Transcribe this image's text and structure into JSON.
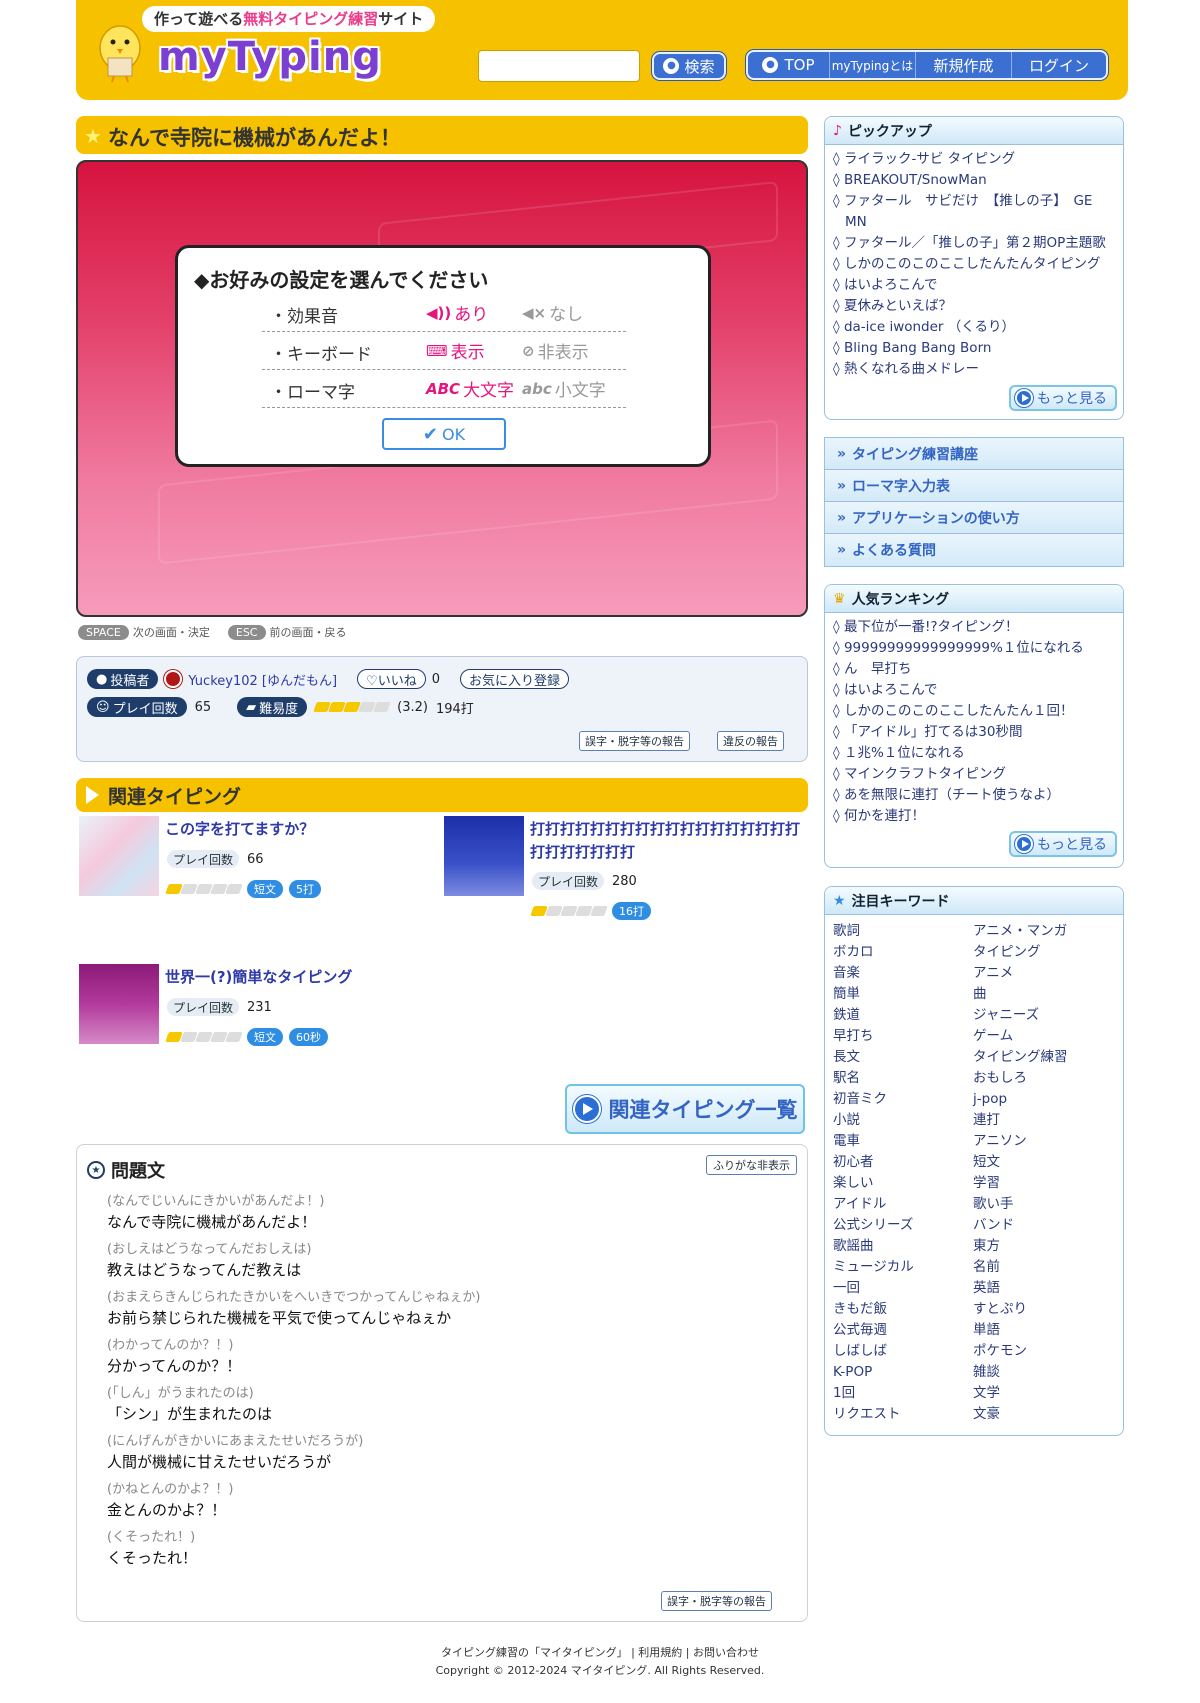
{
  "header": {
    "tagline_pre": "作って遊べる",
    "tagline_hl": "無料タイピング練習",
    "tagline_post": "サイト",
    "logo_text": "myTyping",
    "search_placeholder": "",
    "search_button": "検索",
    "nav": [
      "TOP",
      "myTypingとは",
      "新規作成",
      "ログイン"
    ]
  },
  "title": "なんで寺院に機械があんだよ！",
  "settings": {
    "heading": "◆お好みの設定を選んでください",
    "rows": [
      {
        "label": "・効果音",
        "on": "あり",
        "off": "なし",
        "on_glyph": "◀))",
        "off_glyph": "◀×"
      },
      {
        "label": "・キーボード",
        "on": "表示",
        "off": "非表示",
        "on_glyph": "⌨",
        "off_glyph": "⊘"
      },
      {
        "label": "・ローマ字",
        "on": "大文字",
        "off": "小文字",
        "on_glyph": "ABC",
        "off_glyph": "abc"
      }
    ],
    "ok": "OK"
  },
  "keyhints": {
    "space_key": "SPACE",
    "space_desc": "次の画面・決定",
    "esc_key": "ESC",
    "esc_desc": "前の画面・戻る"
  },
  "info": {
    "poster_label": "投稿者",
    "poster_name": "Yuckey102 [ゆんだもん]",
    "like_label": "♡いいね",
    "like_count": "0",
    "fav_label": "お気に入り登録",
    "plays_label": "プレイ回数",
    "plays_value": "65",
    "difficulty_label": "難易度",
    "difficulty_value": "(3.2)",
    "difficulty_stars": 3,
    "keystrokes": "194打",
    "report_typo": "誤字・脱字等の報告",
    "report_violation": "違反の報告"
  },
  "related": {
    "heading": "関連タイピング",
    "items": [
      {
        "title": "この字を打てますか？",
        "plays_label": "プレイ回数",
        "plays": "66",
        "tags": [
          "短文",
          "5打"
        ],
        "stars": 1
      },
      {
        "title": "打打打打打打打打打打打打打打打打打打打打打打打打打",
        "plays_label": "プレイ回数",
        "plays": "280",
        "tags": [
          "16打"
        ],
        "stars": 1
      },
      {
        "title": "世界一(?)簡単なタイピング",
        "plays_label": "プレイ回数",
        "plays": "231",
        "tags": [
          "短文",
          "60秒"
        ],
        "stars": 1
      }
    ],
    "list_button": "関連タイピング一覧"
  },
  "question": {
    "heading": "問題文",
    "furigana_button": "ふりがな非表示",
    "lines": [
      {
        "kana": "(なんでじいんにきかいがあんだよ！)",
        "text": "なんで寺院に機械があんだよ！"
      },
      {
        "kana": "(おしえはどうなってんだおしえは)",
        "text": "教えはどうなってんだ教えは"
      },
      {
        "kana": "(おまえらきんじられたきかいをへいきでつかってんじゃねぇか)",
        "text": "お前ら禁じられた機械を平気で使ってんじゃねぇか"
      },
      {
        "kana": "(わかってんのか？！)",
        "text": "分かってんのか？！"
      },
      {
        "kana": "(「しん」がうまれたのは)",
        "text": "「シン」が生まれたのは"
      },
      {
        "kana": "(にんげんがきかいにあまえたせいだろうが)",
        "text": "人間が機械に甘えたせいだろうが"
      },
      {
        "kana": "(かねとんのかよ？！)",
        "text": "金とんのかよ？！"
      },
      {
        "kana": "(くそったれ！)",
        "text": "くそったれ！"
      }
    ],
    "report_typo": "誤字・脱字等の報告"
  },
  "sidebar": {
    "pickup": {
      "heading": "ピックアップ",
      "items": [
        "◊ ライラック-サビ タイピング",
        "◊ BREAKOUT/SnowMan",
        "◊ ファタール　サビだけ　【推しの子】　GE",
        "MN",
        "◊ ファタール／「推しの子」第２期OP主題歌",
        "◊ しかのこのこのここしたんたんタイピング",
        "◊ はいよろこんで",
        "◊ 夏休みといえば？",
        "◊ da-ice iwonder （くるり）",
        "◊ Bling Bang Bang Born",
        "◊ 熱くなれる曲メドレー"
      ],
      "more": "もっと見る"
    },
    "links": [
      "タイピング練習講座",
      "ローマ字入力表",
      "アプリケーションの使い方",
      "よくある質問"
    ],
    "ranking": {
      "heading": "人気ランキング",
      "items": [
        "◊ 最下位が一番!?タイピング！",
        "◊ 99999999999999999%１位になれる",
        "◊ ん　早打ち",
        "◊ はいよろこんで",
        "◊ しかのこのこのここしたんたん１回！",
        "◊ 「アイドル」打てるは30秒間",
        "◊ １兆%１位になれる",
        "◊ マインクラフトタイピング",
        "◊ あを無限に連打（チート使うなよ）",
        "◊ 何かを連打！"
      ],
      "more": "もっと見る"
    },
    "keywords": {
      "heading": "注目キーワード",
      "items": [
        "歌詞",
        "アニメ・マンガ",
        "ボカロ",
        "タイピング",
        "音楽",
        "アニメ",
        "簡単",
        "曲",
        "鉄道",
        "ジャニーズ",
        "早打ち",
        "ゲーム",
        "長文",
        "タイピング練習",
        "駅名",
        "おもしろ",
        "初音ミク",
        "j-pop",
        "小説",
        "連打",
        "電車",
        "アニソン",
        "初心者",
        "短文",
        "楽しい",
        "学習",
        "アイドル",
        "歌い手",
        "公式シリーズ",
        "バンド",
        "歌謡曲",
        "東方",
        "ミュージカル",
        "名前",
        "一回",
        "英語",
        "きもだ飯",
        "すとぷり",
        "公式毎週",
        "単語",
        "しばしば",
        "ポケモン",
        "K-POP",
        "雑談",
        "1回",
        "文学",
        "リクエスト",
        "文豪"
      ]
    }
  },
  "footer": {
    "line1": "タイピング練習の「マイタイピング」 | 利用規約 | お問い合わせ",
    "line2": "Copyright © 2012-2024 マイタイピング. All Rights Reserved."
  },
  "colors": {
    "header_yellow": "#f6c200",
    "accent_pink": "#e6147f",
    "nav_blue": "#3b6fd1",
    "link_navy": "#2a3a7a"
  }
}
